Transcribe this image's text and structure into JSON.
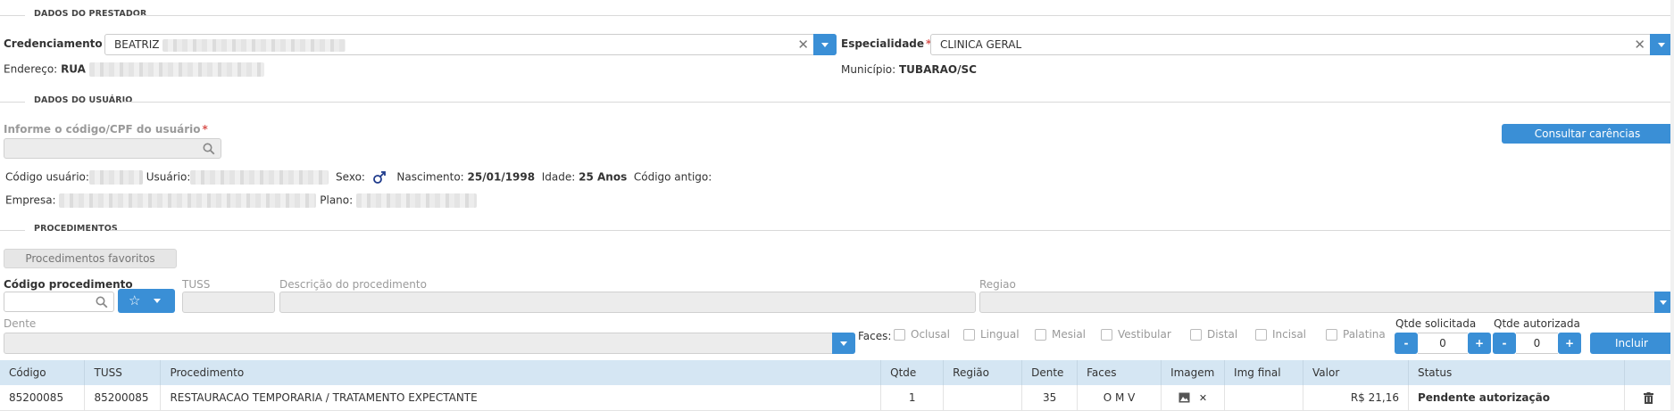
{
  "prestador": {
    "section_title": "DADOS DO PRESTADOR",
    "credenciamento_label": "Credenciamento",
    "credenciamento_value": "BEATRIZ",
    "especialidade_label": "Especialidade",
    "especialidade_value": "CLINICA GERAL",
    "endereco_label": "Endereço:",
    "endereco_value": "RUA",
    "municipio_label": "Município:",
    "municipio_value": "TUBARAO/SC"
  },
  "usuario": {
    "section_title": "DADOS DO USUÁRIO",
    "codigo_cpf_label": "Informe o código/CPF do usuário",
    "consultar_button": "Consultar carências",
    "codigo_usuario_label": "Código usuário:",
    "usuario_label": "Usuário:",
    "sexo_label": "Sexo:",
    "nascimento_label": "Nascimento:",
    "nascimento_value": "25/01/1998",
    "idade_label": "Idade:",
    "idade_value": "25 Anos",
    "codigo_antigo_label": "Código antigo:",
    "empresa_label": "Empresa:",
    "plano_label": "Plano:"
  },
  "procedimentos": {
    "section_title": "PROCEDIMENTOS",
    "favoritos_button": "Procedimentos favoritos",
    "codigo_label": "Código procedimento",
    "tuss_label": "TUSS",
    "descricao_label": "Descrição do procedimento",
    "regiao_label": "Regiao",
    "dente_label": "Dente",
    "faces_label": "Faces:",
    "faces": [
      "Oclusal",
      "Lingual",
      "Mesial",
      "Vestibular",
      "Distal",
      "Incisal",
      "Palatina"
    ],
    "qtde_solicitada_label": "Qtde solicitada",
    "qtde_solicitada_value": "0",
    "qtde_autorizada_label": "Qtde autorizada",
    "qtde_autorizada_value": "0",
    "incluir_button": "Incluir",
    "minus": "-",
    "plus": "+"
  },
  "table": {
    "headers": [
      "Código",
      "TUSS",
      "Procedimento",
      "Qtde",
      "Região",
      "Dente",
      "Faces",
      "Imagem",
      "Img final",
      "Valor",
      "Status",
      ""
    ],
    "rows": [
      {
        "codigo": "85200085",
        "tuss": "85200085",
        "procedimento": "RESTAURACAO TEMPORARIA / TRATAMENTO EXPECTANTE",
        "qtde": "1",
        "regiao": "",
        "dente": "35",
        "faces": "O M V",
        "img_final": "",
        "valor": "R$ 21,16",
        "status": "Pendente autorização"
      }
    ]
  },
  "icons": {
    "sexo": "male-icon",
    "search": "search-icon",
    "star": "star-icon",
    "image": "image-icon",
    "remove": "close-icon",
    "delete": "trash-icon"
  },
  "colors": {
    "accent": "#3a8fd6",
    "table_header": "#d5e6f3",
    "required": "#d9534f"
  }
}
